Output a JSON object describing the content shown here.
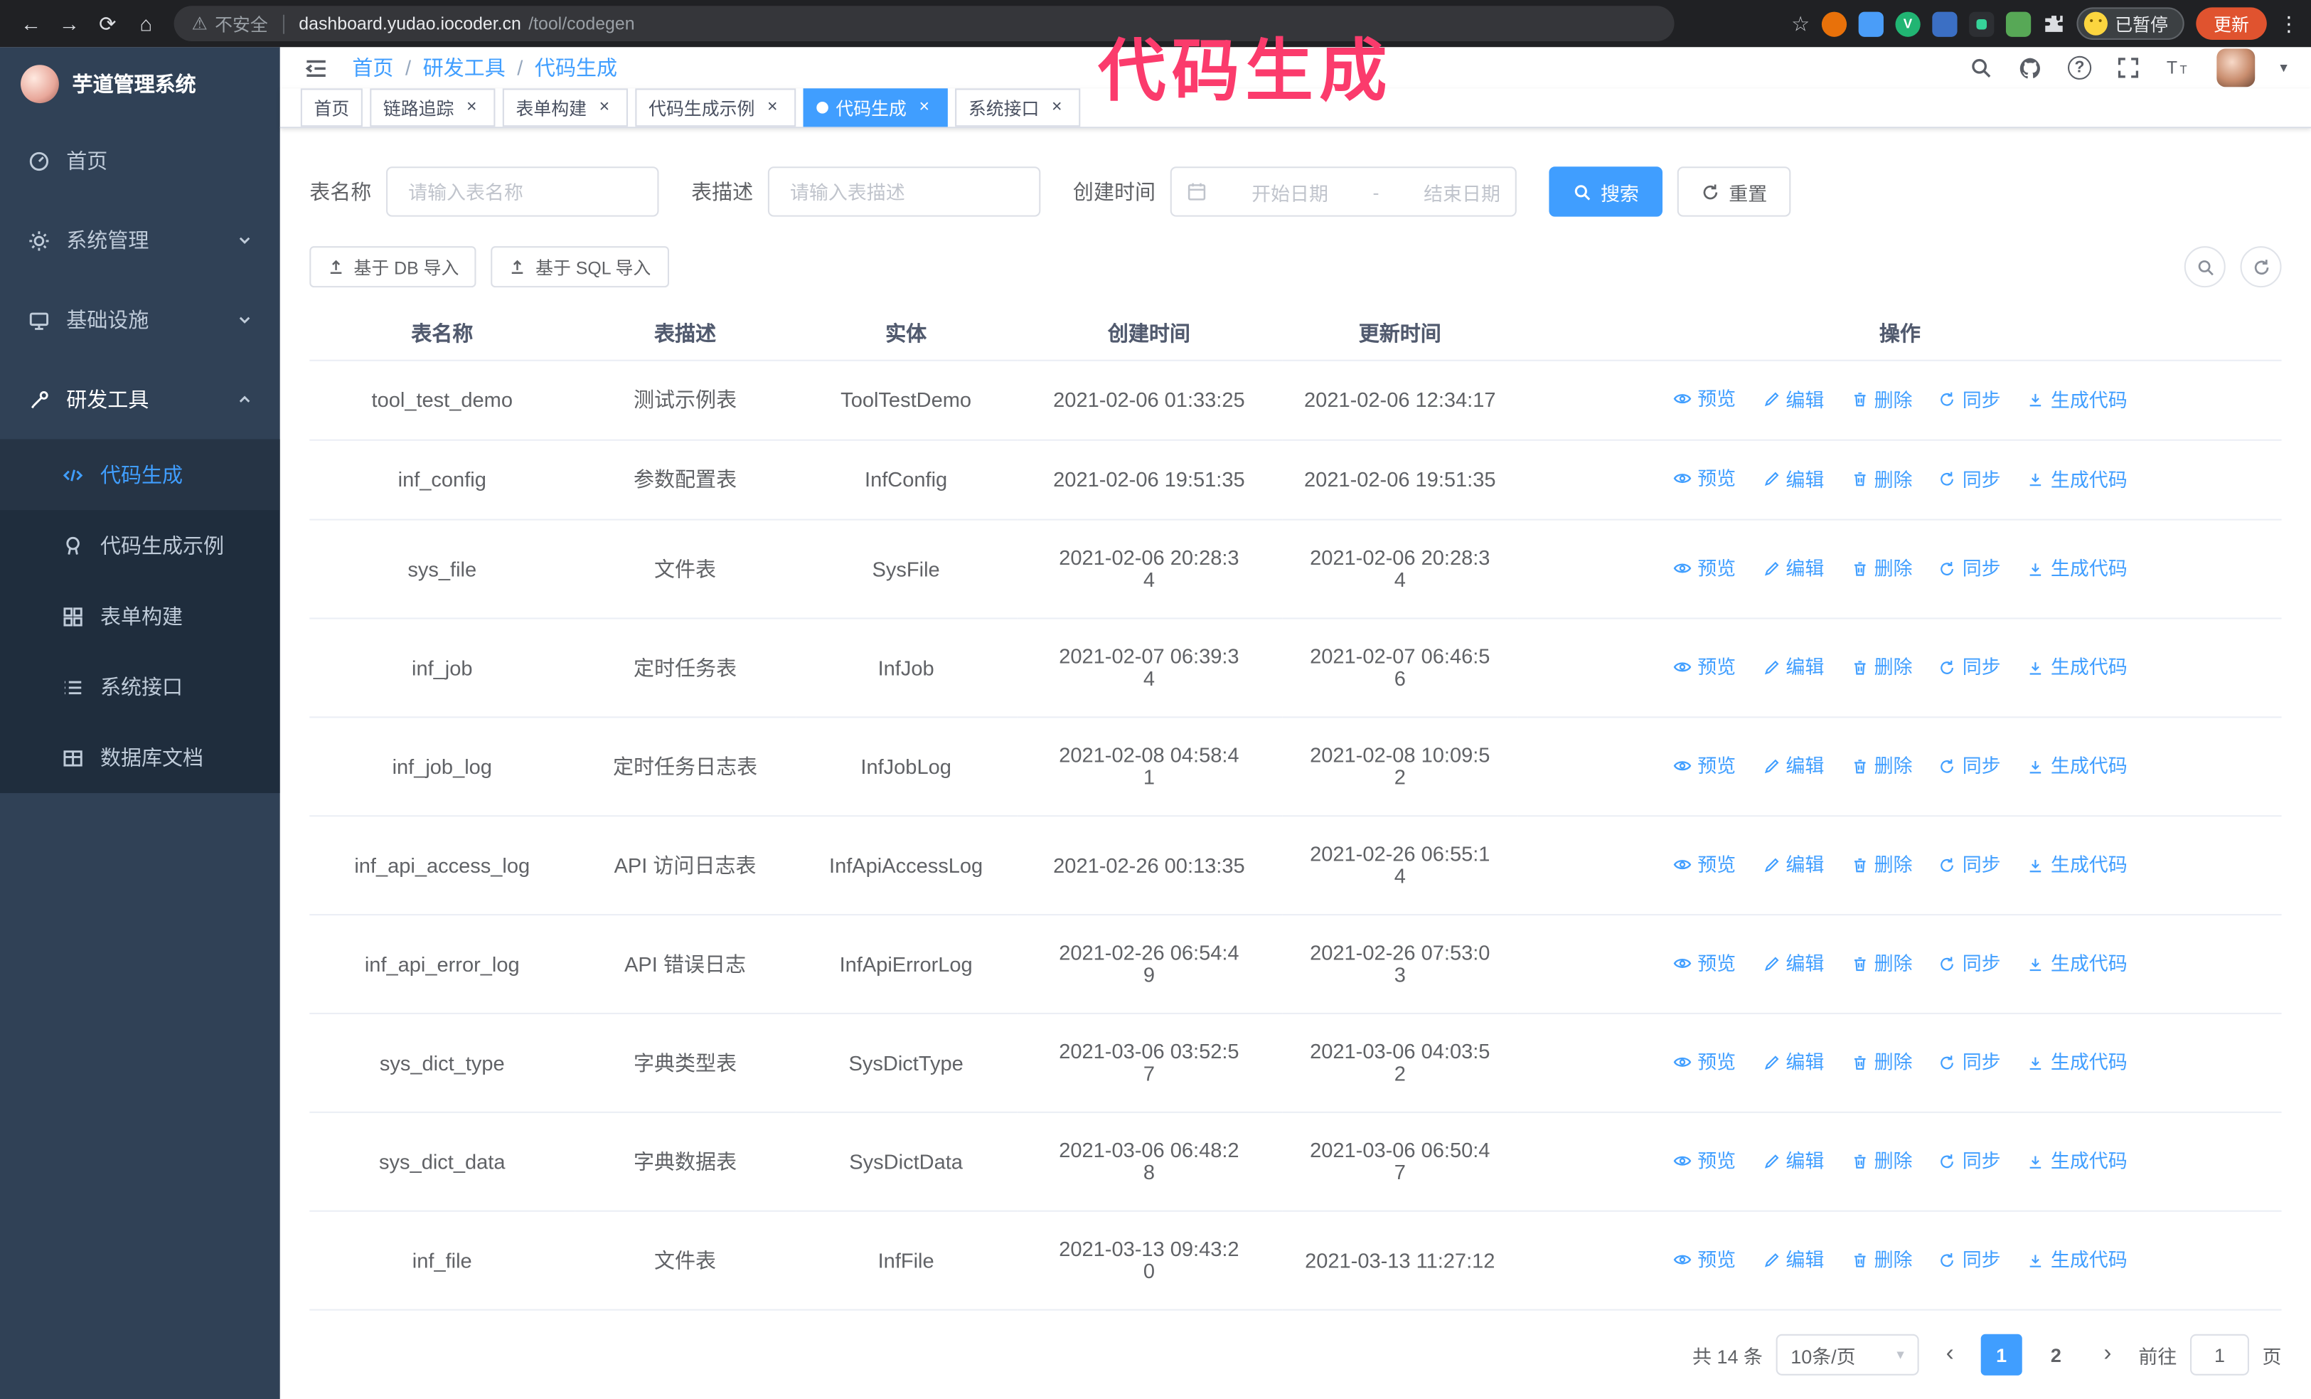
{
  "colors": {
    "accent": "#409EFF",
    "annotation": "#fb3b6c",
    "update_button": "#e0532f",
    "sidebar_bg": "#304156",
    "submenu_bg": "#1f2d3d"
  },
  "annotation": {
    "text": "代码生成"
  },
  "icons": {
    "back": "←",
    "forward": "→",
    "reload": "⟳",
    "home": "⌂",
    "warning": "⚠",
    "star": "☆",
    "dots": "⋮",
    "close": "×",
    "caret_down": "▾",
    "prev": "‹",
    "next": "›",
    "breadcrumb_separator": "/",
    "range_separator": "-",
    "extension_v": "V",
    "question_mark": "?"
  },
  "browser": {
    "security_label": "不安全",
    "url_domain": "dashboard.yudao.iocoder.cn",
    "url_path": "/tool/codegen",
    "paused_badge": "已暂停",
    "update_button": "更新"
  },
  "sidebar": {
    "logo_title": "芋道管理系统",
    "items": [
      {
        "label": "首页"
      },
      {
        "label": "系统管理"
      },
      {
        "label": "基础设施"
      },
      {
        "label": "研发工具"
      }
    ],
    "sub_items": [
      {
        "label": "代码生成",
        "active": true
      },
      {
        "label": "代码生成示例"
      },
      {
        "label": "表单构建"
      },
      {
        "label": "系统接口"
      },
      {
        "label": "数据库文档"
      }
    ]
  },
  "header": {
    "breadcrumb": {
      "items": [
        "首页",
        "研发工具",
        "代码生成"
      ]
    }
  },
  "tags": [
    {
      "label": "首页",
      "closable": false,
      "active": false
    },
    {
      "label": "链路追踪",
      "closable": true,
      "active": false
    },
    {
      "label": "表单构建",
      "closable": true,
      "active": false
    },
    {
      "label": "代码生成示例",
      "closable": true,
      "active": false
    },
    {
      "label": "代码生成",
      "closable": true,
      "active": true
    },
    {
      "label": "系统接口",
      "closable": true,
      "active": false
    }
  ],
  "filters": {
    "table_name_label": "表名称",
    "table_name_placeholder": "请输入表名称",
    "table_desc_label": "表描述",
    "table_desc_placeholder": "请输入表描述",
    "create_time_label": "创建时间",
    "date_start_placeholder": "开始日期",
    "date_end_placeholder": "结束日期",
    "search_button": "搜索",
    "reset_button": "重置"
  },
  "toolbar": {
    "import_db_button": "基于 DB 导入",
    "import_sql_button": "基于 SQL 导入"
  },
  "table": {
    "columns": [
      "表名称",
      "表描述",
      "实体",
      "创建时间",
      "更新时间",
      "操作"
    ],
    "actions": [
      "预览",
      "编辑",
      "删除",
      "同步",
      "生成代码"
    ],
    "rows": [
      {
        "name": "tool_test_demo",
        "desc": "测试示例表",
        "entity": "ToolTestDemo",
        "created": "2021-02-06 01:33:25",
        "updated": "2021-02-06 12:34:17"
      },
      {
        "name": "inf_config",
        "desc": "参数配置表",
        "entity": "InfConfig",
        "created": "2021-02-06 19:51:35",
        "updated": "2021-02-06 19:51:35"
      },
      {
        "name": "sys_file",
        "desc": "文件表",
        "entity": "SysFile",
        "created": "2021-02-06 20:28:3\n4",
        "updated": "2021-02-06 20:28:3\n4"
      },
      {
        "name": "inf_job",
        "desc": "定时任务表",
        "entity": "InfJob",
        "created": "2021-02-07 06:39:3\n4",
        "updated": "2021-02-07 06:46:5\n6"
      },
      {
        "name": "inf_job_log",
        "desc": "定时任务日志表",
        "entity": "InfJobLog",
        "created": "2021-02-08 04:58:4\n1",
        "updated": "2021-02-08 10:09:5\n2"
      },
      {
        "name": "inf_api_access_log",
        "desc": "API 访问日志表",
        "entity": "InfApiAccessLog",
        "created": "2021-02-26 00:13:35",
        "updated": "2021-02-26 06:55:1\n4"
      },
      {
        "name": "inf_api_error_log",
        "desc": "API 错误日志",
        "entity": "InfApiErrorLog",
        "created": "2021-02-26 06:54:4\n9",
        "updated": "2021-02-26 07:53:0\n3"
      },
      {
        "name": "sys_dict_type",
        "desc": "字典类型表",
        "entity": "SysDictType",
        "created": "2021-03-06 03:52:5\n7",
        "updated": "2021-03-06 04:03:5\n2"
      },
      {
        "name": "sys_dict_data",
        "desc": "字典数据表",
        "entity": "SysDictData",
        "created": "2021-03-06 06:48:2\n8",
        "updated": "2021-03-06 06:50:4\n7"
      },
      {
        "name": "inf_file",
        "desc": "文件表",
        "entity": "InfFile",
        "created": "2021-03-13 09:43:2\n0",
        "updated": "2021-03-13 11:27:12"
      }
    ]
  },
  "pagination": {
    "total": "共 14 条",
    "page_size": "10条/页",
    "pages": [
      "1",
      "2"
    ],
    "goto_label": "前往",
    "goto_value": "1",
    "page_unit": "页"
  }
}
